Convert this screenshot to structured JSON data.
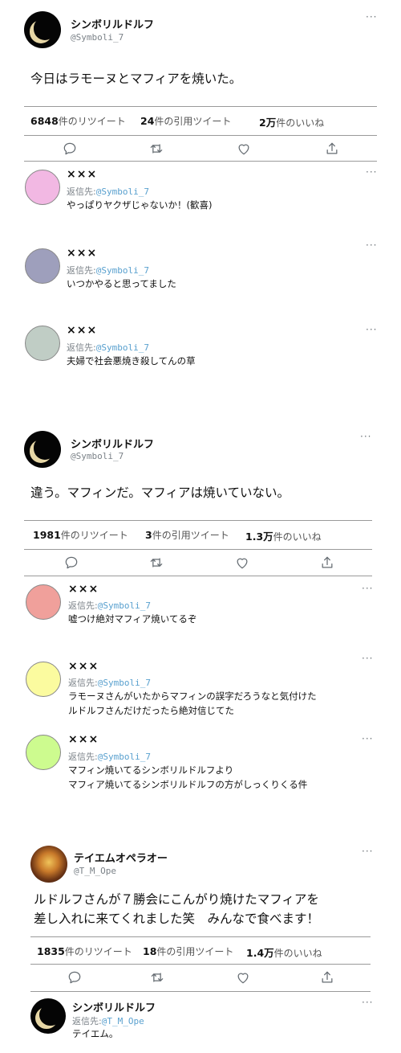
{
  "tweet1": {
    "name": "シンボリルドルフ",
    "handle": "@Symboli_7",
    "text": "今日はラモーヌとマフィアを焼いた。",
    "retweets": "6848",
    "retweets_label": "件のリツイート",
    "quotes": "24",
    "quotes_label": "件の引用ツイート",
    "likes": "2万",
    "likes_label": "件のいいね"
  },
  "replies1": [
    {
      "name": "×××",
      "reply_prefix": "返信先:",
      "mention": "@Symboli_7",
      "text": "やっぱりヤクザじゃないか！(歓喜)",
      "avatar_color": "#f2b8e3"
    },
    {
      "name": "×××",
      "reply_prefix": "返信先:",
      "mention": "@Symboli_7",
      "text": "いつかやると思ってました",
      "avatar_color": "#9e9fbc"
    },
    {
      "name": "×××",
      "reply_prefix": "返信先:",
      "mention": "@Symboli_7",
      "text": "夫婦で社会悪焼き殺してんの草",
      "avatar_color": "#c0cdc5"
    }
  ],
  "tweet2": {
    "name": "シンボリルドルフ",
    "handle": "@Symboli_7",
    "text": "違う。マフィンだ。マフィアは焼いていない。",
    "retweets": "1981",
    "retweets_label": "件のリツイート",
    "quotes": "3",
    "quotes_label": "件の引用ツイート",
    "likes": "1.3万",
    "likes_label": "件のいいね"
  },
  "replies2": [
    {
      "name": "×××",
      "reply_prefix": "返信先:",
      "mention": "@Symboli_7",
      "line1": "嘘つけ絶対マフィア焼いてるぞ",
      "line2": "",
      "avatar_color": "#f0a09b"
    },
    {
      "name": "×××",
      "reply_prefix": "返信先:",
      "mention": "@Symboli_7",
      "line1": "ラモーヌさんがいたからマフィンの誤字だろうなと気付けた",
      "line2": "ルドルフさんだけだったら絶対信じてた",
      "avatar_color": "#fbfb9f"
    },
    {
      "name": "×××",
      "reply_prefix": "返信先:",
      "mention": "@Symboli_7",
      "line1": "マフィン焼いてるシンボリルドルフより",
      "line2": "マフィア焼いてるシンボリルドルフの方がしっくりくる件",
      "avatar_color": "#cdfb8f"
    }
  ],
  "tweet3": {
    "name": "テイエムオペラオー",
    "handle": "@T_M_Ope",
    "line1": "ルドルフさんが７勝会にこんがり焼けたマフィアを",
    "line2": "差し入れに来てくれました笑　みんなで食べます！",
    "retweets": "1835",
    "retweets_label": "件のリツイート",
    "quotes": "18",
    "quotes_label": "件の引用ツイート",
    "likes": "1.4万",
    "likes_label": "件のいいね"
  },
  "reply3": {
    "name": "シンボリルドルフ",
    "reply_prefix": "返信先:",
    "mention": "@T_M_Ope",
    "text": "テイエム。"
  },
  "more_label": "···",
  "icons": [
    "reply-icon",
    "retweet-icon",
    "like-icon",
    "share-icon",
    "more-icon"
  ]
}
